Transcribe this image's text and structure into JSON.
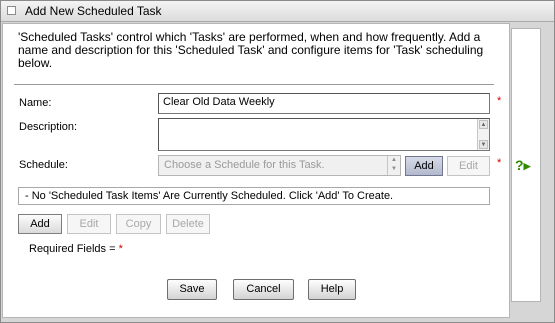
{
  "window": {
    "title": "Add New Scheduled Task"
  },
  "intro": "'Scheduled Tasks' control which 'Tasks' are performed, when and how frequently. Add a name and description for this 'Scheduled Task' and configure items for 'Task' scheduling below.",
  "form": {
    "name_label": "Name:",
    "name_value": "Clear Old Data Weekly",
    "description_label": "Description:",
    "description_value": "",
    "schedule_label": "Schedule:",
    "schedule_placeholder": "Choose a Schedule for this Task.",
    "schedule_add": "Add",
    "schedule_edit": "Edit",
    "required_marker": "*"
  },
  "items": {
    "empty_message": "- No 'Scheduled Task Items' Are Currently Scheduled. Click 'Add' To Create.",
    "buttons": {
      "add": "Add",
      "edit": "Edit",
      "copy": "Copy",
      "delete": "Delete"
    }
  },
  "required_note": "Required Fields =",
  "footer": {
    "save": "Save",
    "cancel": "Cancel",
    "help": "Help"
  },
  "help_icon": {
    "glyph": "?",
    "name": "help-arrow-icon"
  },
  "colors": {
    "required": "#d40000",
    "help": "#2e8b00"
  }
}
